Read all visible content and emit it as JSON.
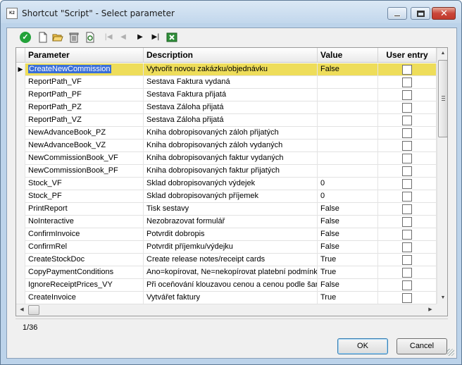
{
  "window": {
    "title": "Shortcut \"Script\" - Select parameter",
    "icon_label": "K2"
  },
  "grid": {
    "columns": [
      "Parameter",
      "Description",
      "Value",
      "User entry"
    ],
    "selected_index": 0,
    "rows": [
      {
        "parameter": "CreateNewCommission",
        "description": "Vytvořit novou zakázku/objednávku",
        "value": "False",
        "user_entry": false
      },
      {
        "parameter": "ReportPath_VF",
        "description": "Sestava Faktura vydaná",
        "value": "",
        "user_entry": false
      },
      {
        "parameter": "ReportPath_PF",
        "description": "Sestava Faktura přijatá",
        "value": "",
        "user_entry": false
      },
      {
        "parameter": "ReportPath_PZ",
        "description": "Sestava Záloha přijatá",
        "value": "",
        "user_entry": false
      },
      {
        "parameter": "ReportPath_VZ",
        "description": "Sestava Záloha přijatá",
        "value": "",
        "user_entry": false
      },
      {
        "parameter": "NewAdvanceBook_PZ",
        "description": "Kniha dobropisovaných záloh přijatých",
        "value": "",
        "user_entry": false
      },
      {
        "parameter": "NewAdvanceBook_VZ",
        "description": "Kniha dobropisovaných záloh vydaných",
        "value": "",
        "user_entry": false
      },
      {
        "parameter": "NewCommissionBook_VF",
        "description": "Kniha dobropisovaných faktur vydaných",
        "value": "",
        "user_entry": false
      },
      {
        "parameter": "NewCommissionBook_PF",
        "description": "Kniha dobropisovaných faktur přijatých",
        "value": "",
        "user_entry": false
      },
      {
        "parameter": "Stock_VF",
        "description": "Sklad dobropisovaných výdejek",
        "value": "0",
        "user_entry": false
      },
      {
        "parameter": "Stock_PF",
        "description": "Sklad dobropisovaných příjemek",
        "value": "0",
        "user_entry": false
      },
      {
        "parameter": "PrintReport",
        "description": "Tisk sestavy",
        "value": "False",
        "user_entry": false
      },
      {
        "parameter": "NoInteractive",
        "description": "Nezobrazovat formulář",
        "value": "False",
        "user_entry": false
      },
      {
        "parameter": "ConfirmInvoice",
        "description": "Potvrdit dobropis",
        "value": "False",
        "user_entry": false
      },
      {
        "parameter": "ConfirmRel",
        "description": "Potvrdit příjemku/výdejku",
        "value": "False",
        "user_entry": false
      },
      {
        "parameter": "CreateStockDoc",
        "description": "Create release notes/receipt cards",
        "value": "True",
        "user_entry": false
      },
      {
        "parameter": "CopyPaymentConditions",
        "description": "Ano=kopírovat, Ne=nekopírovat platební podmínky",
        "value": "True",
        "user_entry": false
      },
      {
        "parameter": "IgnoreReceiptPrices_VY",
        "description": "Při oceňování klouzavou cenou a cenou podle šarž",
        "value": "False",
        "user_entry": false
      },
      {
        "parameter": "CreateInvoice",
        "description": "Vytvářet faktury",
        "value": "True",
        "user_entry": false
      }
    ]
  },
  "status": {
    "record": "1/36"
  },
  "buttons": {
    "ok": "OK",
    "cancel": "Cancel"
  }
}
